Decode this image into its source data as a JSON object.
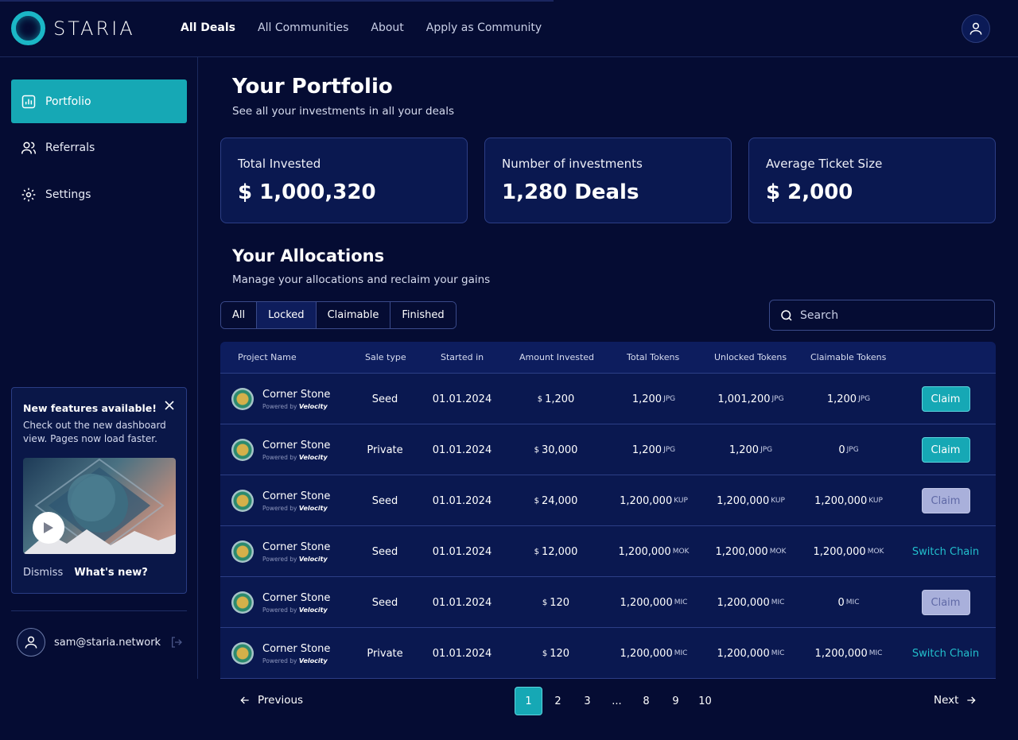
{
  "brand": {
    "name": "STARIA"
  },
  "nav": {
    "items": [
      {
        "label": "All Deals",
        "active": true
      },
      {
        "label": "All Communities",
        "active": false
      },
      {
        "label": "About",
        "active": false
      },
      {
        "label": "Apply as Community",
        "active": false
      }
    ]
  },
  "sidebar": {
    "items": [
      {
        "label": "Portfolio",
        "icon": "chart-icon",
        "active": true
      },
      {
        "label": "Referrals",
        "icon": "users-icon",
        "active": false
      },
      {
        "label": "Settings",
        "icon": "gear-icon",
        "active": false
      }
    ],
    "promo": {
      "title": "New features available!",
      "text": "Check out the new dashboard view. Pages now load faster.",
      "dismiss": "Dismiss",
      "whats_new": "What's new?"
    },
    "user": {
      "email": "sam@staria.network"
    }
  },
  "portfolio": {
    "title": "Your Portfolio",
    "subtitle": "See all your investments in all your deals",
    "stats": [
      {
        "label": "Total Invested",
        "value": "$ 1,000,320"
      },
      {
        "label": "Number of investments",
        "value": "1,280 Deals"
      },
      {
        "label": "Average Ticket Size",
        "value": "$ 2,000"
      }
    ]
  },
  "allocations": {
    "title": "Your Allocations",
    "subtitle": "Manage your allocations and reclaim your gains",
    "filters": [
      {
        "label": "All",
        "active": false
      },
      {
        "label": "Locked",
        "active": true
      },
      {
        "label": "Claimable",
        "active": false
      },
      {
        "label": "Finished",
        "active": false
      }
    ],
    "search": {
      "placeholder": "Search"
    },
    "columns": [
      "Project Name",
      "Sale type",
      "Started in",
      "Amount Invested",
      "Total Tokens",
      "Unlocked Tokens",
      "Claimable Tokens"
    ],
    "rows": [
      {
        "project": "Corner Stone",
        "powered_prefix": "Powered by",
        "powered_by": "Velocity",
        "sale_type": "Seed",
        "started": "01.01.2024",
        "currency": "$",
        "amount": "1,200",
        "total": "1,200",
        "total_unit": "JPG",
        "unlocked": "1,001,200",
        "unlocked_unit": "JPG",
        "claimable": "1,200",
        "claimable_unit": "JPG",
        "action": "Claim",
        "action_type": "claim"
      },
      {
        "project": "Corner Stone",
        "powered_prefix": "Powered by",
        "powered_by": "Velocity",
        "sale_type": "Private",
        "started": "01.01.2024",
        "currency": "$",
        "amount": "30,000",
        "total": "1,200",
        "total_unit": "JPG",
        "unlocked": "1,200",
        "unlocked_unit": "JPG",
        "claimable": "0",
        "claimable_unit": "JPG",
        "action": "Claim",
        "action_type": "claim"
      },
      {
        "project": "Corner Stone",
        "powered_prefix": "Powered by",
        "powered_by": "Velocity",
        "sale_type": "Seed",
        "started": "01.01.2024",
        "currency": "$",
        "amount": "24,000",
        "total": "1,200,000",
        "total_unit": "KUP",
        "unlocked": "1,200,000",
        "unlocked_unit": "KUP",
        "claimable": "1,200,000",
        "claimable_unit": "KUP",
        "action": "Claim",
        "action_type": "claim-disabled"
      },
      {
        "project": "Corner Stone",
        "powered_prefix": "Powered by",
        "powered_by": "Velocity",
        "sale_type": "Seed",
        "started": "01.01.2024",
        "currency": "$",
        "amount": "12,000",
        "total": "1,200,000",
        "total_unit": "MOK",
        "unlocked": "1,200,000",
        "unlocked_unit": "MOK",
        "claimable": "1,200,000",
        "claimable_unit": "MOK",
        "action": "Switch Chain",
        "action_type": "switch"
      },
      {
        "project": "Corner Stone",
        "powered_prefix": "Powered by",
        "powered_by": "Velocity",
        "sale_type": "Seed",
        "started": "01.01.2024",
        "currency": "$",
        "amount": "120",
        "total": "1,200,000",
        "total_unit": "MIC",
        "unlocked": "1,200,000",
        "unlocked_unit": "MIC",
        "claimable": "0",
        "claimable_unit": "MIC",
        "action": "Claim",
        "action_type": "claim-disabled"
      },
      {
        "project": "Corner Stone",
        "powered_prefix": "Powered by",
        "powered_by": "Velocity",
        "sale_type": "Private",
        "started": "01.01.2024",
        "currency": "$",
        "amount": "120",
        "total": "1,200,000",
        "total_unit": "MIC",
        "unlocked": "1,200,000",
        "unlocked_unit": "MIC",
        "claimable": "1,200,000",
        "claimable_unit": "MIC",
        "action": "Switch Chain",
        "action_type": "switch"
      }
    ]
  },
  "pagination": {
    "previous": "Previous",
    "next": "Next",
    "pages": [
      "1",
      "2",
      "3",
      "...",
      "8",
      "9",
      "10"
    ],
    "current": "1"
  },
  "colors": {
    "accent": "#16a8b5",
    "background": "#050c33",
    "card": "#0a1850"
  }
}
